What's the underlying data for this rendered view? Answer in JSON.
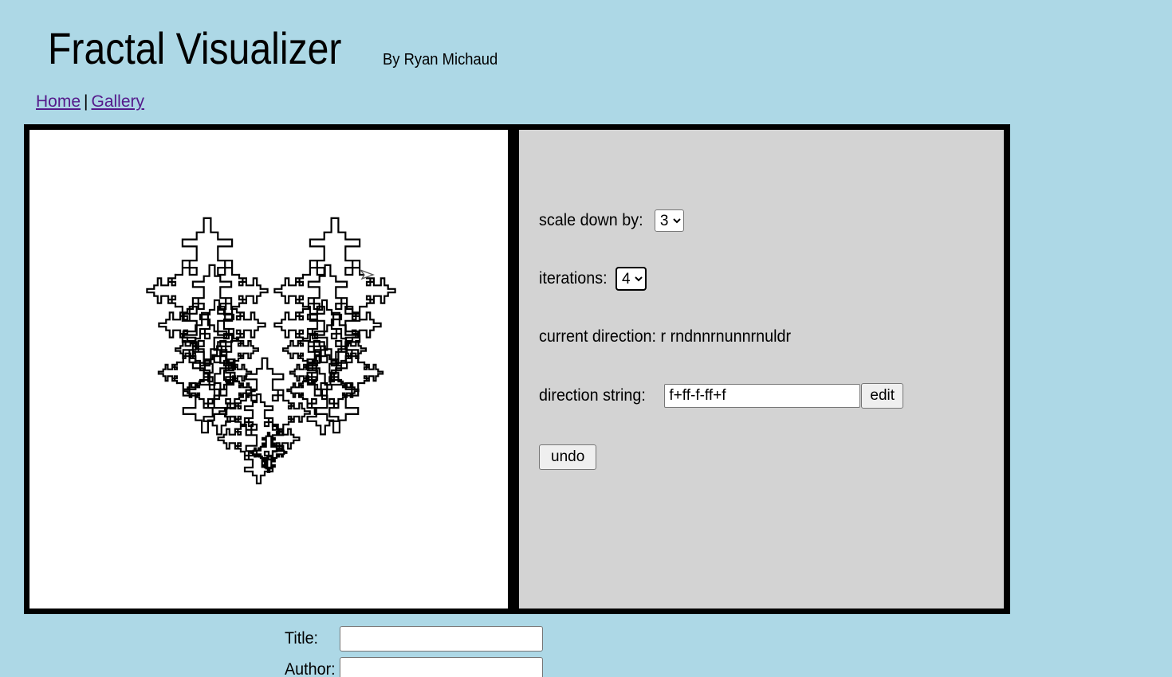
{
  "header": {
    "title": "Fractal Visualizer",
    "byline": "By Ryan Michaud"
  },
  "nav": {
    "home": "Home",
    "separator": "|",
    "gallery": "Gallery"
  },
  "controls": {
    "scale_label": "scale down by:",
    "scale_value": "3",
    "iterations_label": "iterations:",
    "iterations_value": "4",
    "current_direction_label": "current direction:",
    "current_direction_value": "r rndnnrnunnrnuldr",
    "direction_string_label": "direction string:",
    "direction_string_value": "f+ff-f-ff+f",
    "edit_label": "edit",
    "undo_label": "undo"
  },
  "form": {
    "title_label": "Title:",
    "author_label": "Author:"
  },
  "colors": {
    "page_background": "#add8e6",
    "frame_border": "#000000",
    "canvas_background": "#ffffff",
    "panel_background": "#d3d3d3",
    "link": "#551a8b"
  },
  "icons": {
    "cursor": "turtle-arrow-icon"
  }
}
